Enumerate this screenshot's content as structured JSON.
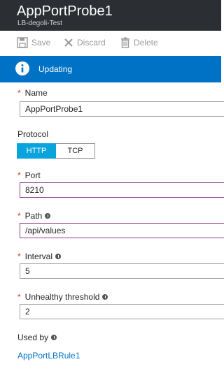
{
  "header": {
    "title": "AppPortProbe1",
    "subtitle": "LB-degoli-Test"
  },
  "toolbar": {
    "save_label": "Save",
    "discard_label": "Discard",
    "delete_label": "Delete"
  },
  "banner": {
    "text": "Updating",
    "icon": "info-icon"
  },
  "form": {
    "name_label": "Name",
    "name_value": "AppPortProbe1",
    "protocol_label": "Protocol",
    "protocol_options": [
      "HTTP",
      "TCP"
    ],
    "protocol_selected": "HTTP",
    "port_label": "Port",
    "port_value": "8210",
    "path_label": "Path",
    "path_value": "/api/values",
    "interval_label": "Interval",
    "interval_value": "5",
    "threshold_label": "Unhealthy threshold",
    "threshold_value": "2",
    "used_by_label": "Used by",
    "used_by_link": "AppPortLBRule1",
    "required_marker": "*"
  },
  "colors": {
    "header_bg": "#2b2f33",
    "banner_bg": "#0072c6",
    "selected_toggle": "#0aa4dc",
    "link": "#0072c6",
    "required": "#c0392b"
  }
}
